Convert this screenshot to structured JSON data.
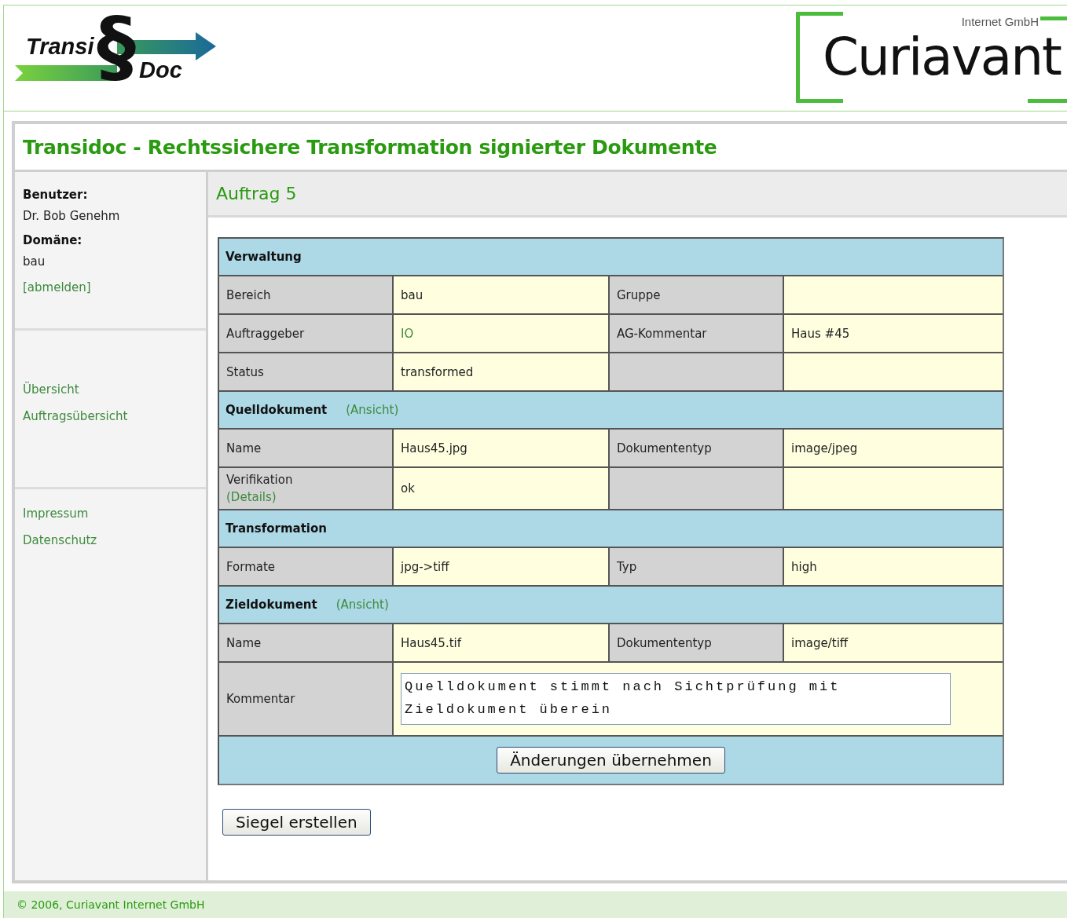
{
  "header": {
    "logo_left": "Transi",
    "logo_mark": "§",
    "logo_right": "Doc",
    "company_small": "Internet GmbH",
    "company": "Curiavant"
  },
  "title": "Transidoc - Rechtssichere Transformation signierter Dokumente",
  "sidebar": {
    "user_label": "Benutzer:",
    "user": "Dr. Bob Genehm",
    "domain_label": "Domäne:",
    "domain": "bau",
    "logout": "[abmelden]",
    "nav": [
      "Übersicht",
      "Auftragsübersicht"
    ],
    "links": [
      "Impressum",
      "Datenschutz"
    ]
  },
  "heading": "Auftrag 5",
  "rows": [
    {
      "kind": "section",
      "title": "Verwaltung"
    },
    {
      "kind": "fields",
      "cells": [
        {
          "kind": "label",
          "text": "Bereich"
        },
        {
          "kind": "value",
          "text": "bau"
        },
        {
          "kind": "label",
          "text": "Gruppe"
        },
        {
          "kind": "value"
        }
      ]
    },
    {
      "kind": "fields",
      "cells": [
        {
          "kind": "label",
          "text": "Auftraggeber"
        },
        {
          "kind": "link",
          "text": "IO"
        },
        {
          "kind": "label",
          "text": "AG-Kommentar"
        },
        {
          "kind": "value",
          "text": "Haus #45"
        }
      ]
    },
    {
      "kind": "fields",
      "cells": [
        {
          "kind": "label",
          "text": "Status"
        },
        {
          "kind": "value",
          "text": "transformed"
        },
        {
          "kind": "label"
        },
        {
          "kind": "value"
        }
      ]
    },
    {
      "kind": "section",
      "title": "Quelldokument",
      "link": "(Ansicht)"
    },
    {
      "kind": "fields",
      "cells": [
        {
          "kind": "label",
          "text": "Name"
        },
        {
          "kind": "value",
          "text": "Haus45.jpg"
        },
        {
          "kind": "label",
          "text": "Dokumententyp"
        },
        {
          "kind": "value",
          "text": "image/jpeg"
        }
      ]
    },
    {
      "kind": "fields",
      "cells": [
        {
          "kind": "label",
          "text": "Verifikation",
          "link": "(Details)"
        },
        {
          "kind": "value",
          "text": "ok"
        },
        {
          "kind": "label"
        },
        {
          "kind": "value"
        }
      ]
    },
    {
      "kind": "section",
      "title": "Transformation"
    },
    {
      "kind": "fields",
      "cells": [
        {
          "kind": "label",
          "text": "Formate"
        },
        {
          "kind": "value",
          "text": "jpg->tiff"
        },
        {
          "kind": "label",
          "text": "Typ"
        },
        {
          "kind": "value",
          "text": "high"
        }
      ]
    },
    {
      "kind": "section",
      "title": "Zieldokument",
      "link": "(Ansicht)"
    },
    {
      "kind": "fields",
      "cells": [
        {
          "kind": "label",
          "text": "Name"
        },
        {
          "kind": "value",
          "text": "Haus45.tif"
        },
        {
          "kind": "label",
          "text": "Dokumententyp"
        },
        {
          "kind": "value",
          "text": "image/tiff"
        }
      ]
    },
    {
      "kind": "comment",
      "label": "Kommentar",
      "value": "Quelldokument stimmt nach Sichtprüfung mit Zieldokument überein"
    },
    {
      "kind": "actions",
      "button": "Änderungen übernehmen"
    }
  ],
  "seal_button": "Siegel erstellen",
  "footer": "© 2006, Curiavant Internet GmbH"
}
